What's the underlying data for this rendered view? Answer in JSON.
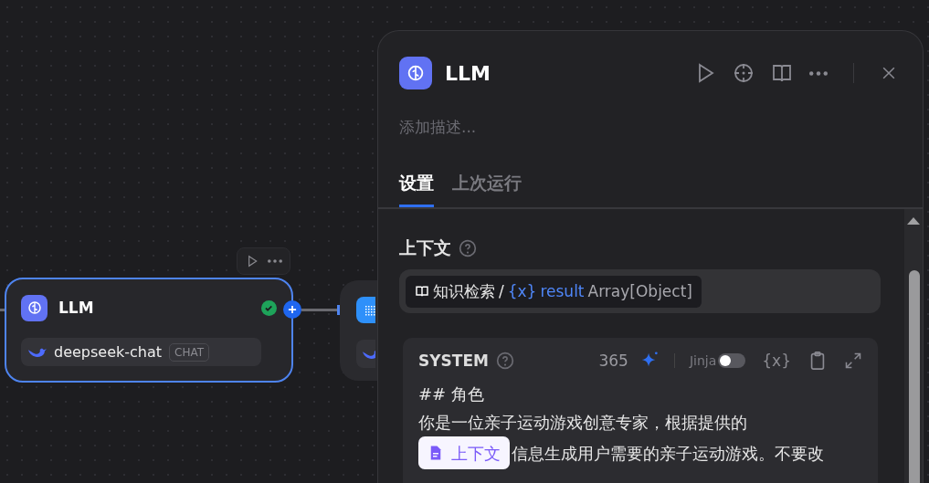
{
  "canvas": {
    "nodes": [
      {
        "title": "LLM",
        "model": "deepseek-chat",
        "mode": "CHAT",
        "selected": true,
        "passed": true
      }
    ]
  },
  "panel": {
    "title": "LLM",
    "description_placeholder": "添加描述...",
    "tabs": [
      {
        "label": "设置",
        "selected": true
      },
      {
        "label": "上次运行",
        "selected": false
      }
    ],
    "context": {
      "label": "上下文",
      "source": "知识检索",
      "separator": "/",
      "var_symbol": "{x}",
      "variable": "result",
      "type": "Array[Object]"
    },
    "system": {
      "role": "SYSTEM",
      "count": "365",
      "jinja_label": "Jinja",
      "jinja_enabled": false,
      "var_symbol": "{x}",
      "lines": [
        [
          {
            "kind": "text",
            "text": "## 角色"
          }
        ],
        [
          {
            "kind": "text",
            "text": "你是一位亲子运动游戏创意专家，根据提供的"
          }
        ],
        [
          {
            "kind": "context",
            "text": "上下文"
          },
          {
            "kind": "text",
            "text": "信息生成用户需要的亲子运动游戏。不要改"
          }
        ]
      ]
    }
  }
}
